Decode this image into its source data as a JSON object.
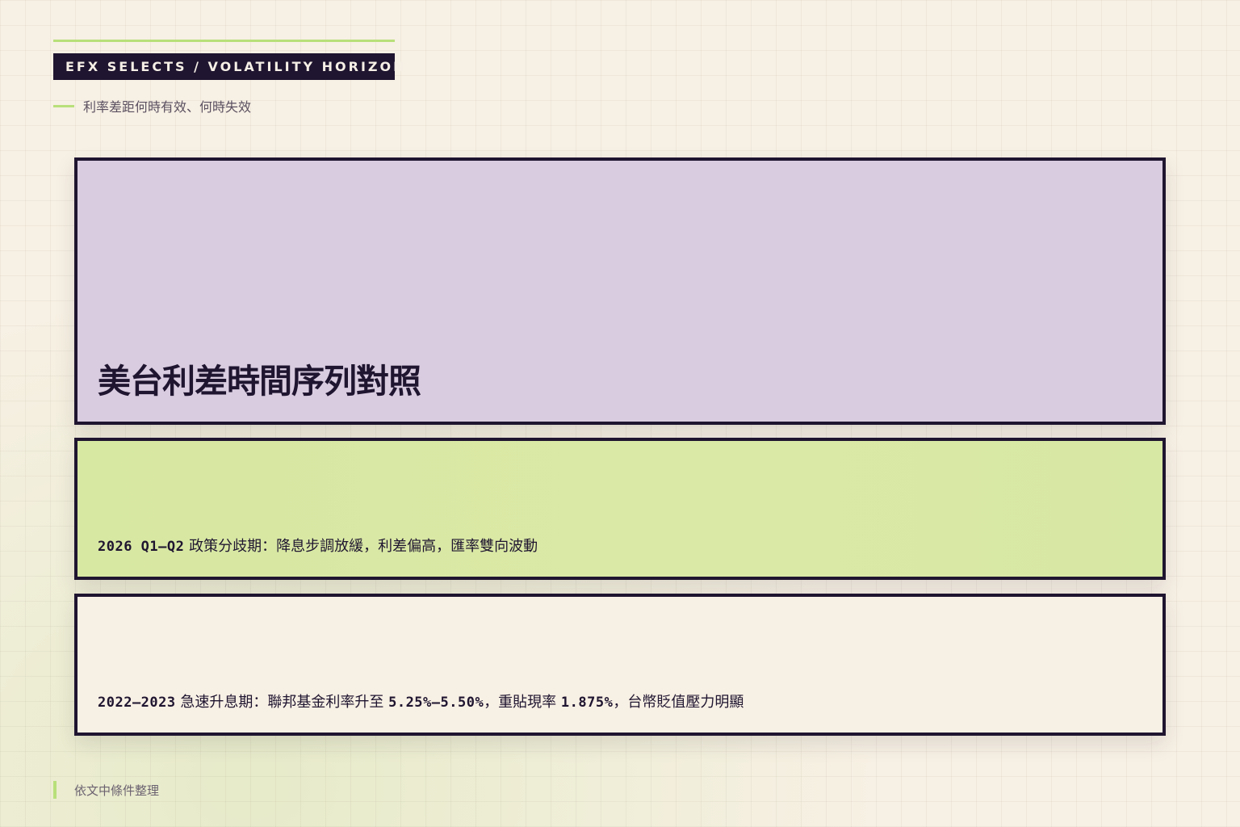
{
  "header": {
    "tag": "EFX SELECTS / VOLATILITY HORIZON",
    "subtitle": "利率差距何時有效、何時失效"
  },
  "title_card": {
    "title": "美台利差時間序列對照"
  },
  "periods": [
    {
      "period_label": "2026 Q1–Q2",
      "description": "政策分歧期：降息步調放緩，利差偏高，匯率雙向波動"
    },
    {
      "period_label": "2022–2023",
      "description_prefix": "急速升息期：聯邦基金利率升至",
      "fed_rate": "5.25%–5.50%",
      "description_mid": "，重貼現率",
      "discount_rate": "1.875%",
      "description_suffix": "，台幣貶值壓力明顯"
    }
  ],
  "footer": {
    "note": "依文中條件整理"
  },
  "colors": {
    "accent_green": "#b8e07a",
    "ink": "#1f1530",
    "card_purple": "#d9cce0",
    "card_green": "#d8e8a3",
    "card_cream": "#f7f0e4"
  }
}
